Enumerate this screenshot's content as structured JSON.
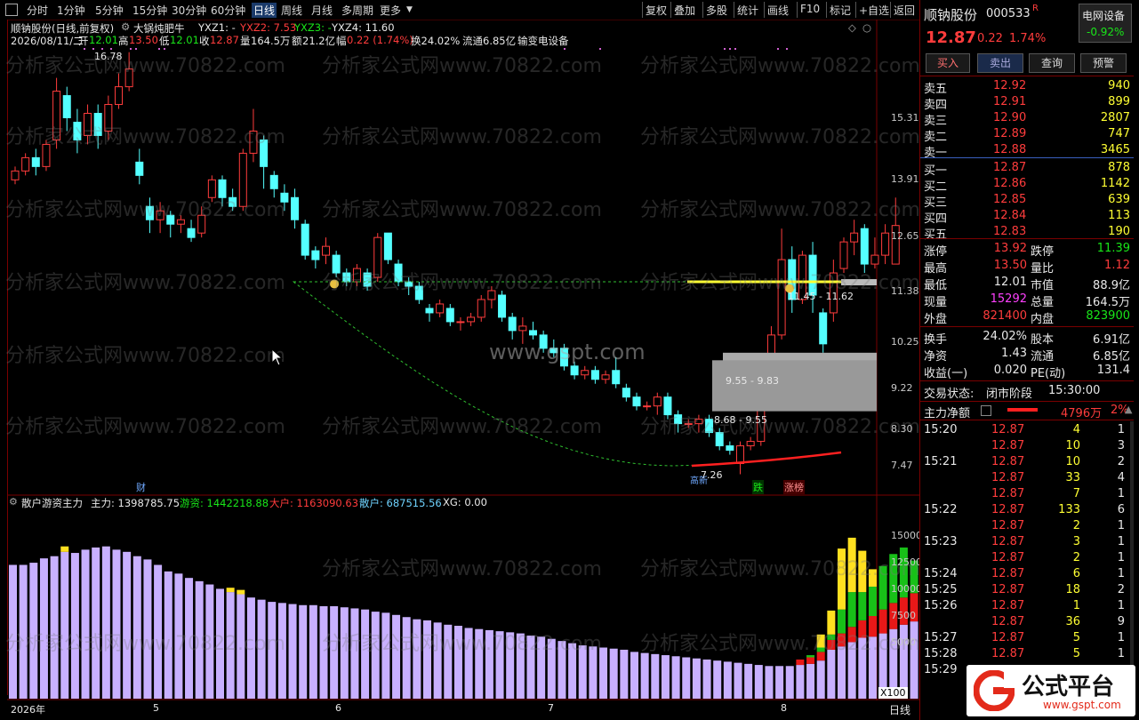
{
  "toolbar": {
    "periods": [
      "分时",
      "1分钟",
      "5分钟",
      "15分钟",
      "30分钟",
      "60分钟",
      "日线",
      "周线",
      "月线",
      "多周期",
      "更多"
    ],
    "active_period": "日线",
    "right_buttons": [
      "复权",
      "叠加",
      "多股",
      "统计",
      "画线",
      "F10",
      "标记",
      "+自选",
      "返回"
    ]
  },
  "chart_header": {
    "stock_label": "顺钠股份(日线,前复权)",
    "indicator_name": "大锅炖肥牛",
    "yxz1": "YXZ1: -",
    "yxz2": "YXZ2: 7.53",
    "yxz3": "YXZ3: -",
    "yxz4": "YXZ4: 11.60"
  },
  "quote_line": {
    "date": "2026/08/11/二",
    "open_label": "开",
    "open": "12.01",
    "high_label": "高",
    "high": "13.50",
    "low_label": "低",
    "low": "12.01",
    "close_label": "收",
    "close": "12.87",
    "vol_label": "量",
    "vol": "164.5万",
    "amount_label": "额",
    "amount": "21.2亿",
    "change_label": "幅",
    "change": "0.22 (1.74%)",
    "turnover": "换24.02%",
    "float": "流通6.85亿",
    "industry": "输变电设备"
  },
  "price_axis": [
    "15.31",
    "13.91",
    "12.65",
    "11.38",
    "10.25",
    "9.22",
    "8.30",
    "7.47"
  ],
  "chart_annotations": {
    "peak_label": "16.78",
    "low_label": "7.26",
    "box1": "11.45 - 11.62",
    "box2": "9.55 - 9.83",
    "box3": "8.68 - 9.55",
    "tag_cai": "财",
    "tag_die": "跌",
    "tag_zhangbang": "涨榜",
    "tag_gaoxin": "高新",
    "watermark": "分析家公式网www.70822.com",
    "watermark2": "www.gspt.com"
  },
  "sub_header": {
    "name": "散户游资主力",
    "zhuli": "主力: 1398785.75",
    "youzi": "游资: 1442218.88",
    "dahu": "大户: 1163090.63",
    "sanhu": "散户: 687515.56",
    "xg": "XG: 0.00"
  },
  "sub_axis": [
    "15000",
    "12500",
    "10000",
    "7500",
    "5000"
  ],
  "sub_axis_unit": "X100",
  "bottom_axis": {
    "labels": [
      "2026年",
      "5",
      "6",
      "7",
      "8"
    ],
    "right_label": "日线"
  },
  "stock_panel": {
    "name": "顺钠股份",
    "code": "000533",
    "r_badge": "R",
    "sector_name": "电网设备",
    "sector_change": "-0.92%",
    "price": "12.87",
    "change": "0.22",
    "change_pct": "1.74%",
    "buttons": [
      "买入",
      "卖出",
      "查询",
      "预警"
    ]
  },
  "sell_levels": [
    {
      "label": "卖五",
      "price": "12.92",
      "vol": "940"
    },
    {
      "label": "卖四",
      "price": "12.91",
      "vol": "899"
    },
    {
      "label": "卖三",
      "price": "12.90",
      "vol": "2807"
    },
    {
      "label": "卖二",
      "price": "12.89",
      "vol": "747"
    },
    {
      "label": "卖一",
      "price": "12.88",
      "vol": "3465"
    }
  ],
  "buy_levels": [
    {
      "label": "买一",
      "price": "12.87",
      "vol": "878"
    },
    {
      "label": "买二",
      "price": "12.86",
      "vol": "1142"
    },
    {
      "label": "买三",
      "price": "12.85",
      "vol": "639"
    },
    {
      "label": "买四",
      "price": "12.84",
      "vol": "113"
    },
    {
      "label": "买五",
      "price": "12.83",
      "vol": "190"
    }
  ],
  "stats": [
    {
      "l1": "涨停",
      "v1": "13.92",
      "c1": "red",
      "l2": "跌停",
      "v2": "11.39",
      "c2": "green"
    },
    {
      "l1": "最高",
      "v1": "13.50",
      "c1": "red",
      "l2": "量比",
      "v2": "1.12",
      "c2": "red"
    },
    {
      "l1": "最低",
      "v1": "12.01",
      "c1": "white",
      "l2": "市值",
      "v2": "88.9亿",
      "c2": "white"
    },
    {
      "l1": "现量",
      "v1": "15292",
      "c1": "magenta",
      "l2": "总量",
      "v2": "164.5万",
      "c2": "white"
    },
    {
      "l1": "外盘",
      "v1": "821400",
      "c1": "red",
      "l2": "内盘",
      "v2": "823900",
      "c2": "green"
    }
  ],
  "stats2": [
    {
      "l1": "换手",
      "v1": "24.02%",
      "l2": "股本",
      "v2": "6.91亿"
    },
    {
      "l1": "净资",
      "v1": "1.43",
      "l2": "流通",
      "v2": "6.85亿"
    },
    {
      "l1": "收益(一)",
      "v1": "0.020",
      "l2": "PE(动)",
      "v2": "131.4"
    }
  ],
  "trade_state": {
    "label": "交易状态:",
    "value": "闭市阶段",
    "time": "15:30:00"
  },
  "net_flow": {
    "label": "主力净额",
    "value": "4796万",
    "pct": "2%"
  },
  "ticks": [
    {
      "time": "15:20",
      "price": "12.87",
      "vol": "4",
      "n": "1"
    },
    {
      "time": "",
      "price": "12.87",
      "vol": "10",
      "n": "3"
    },
    {
      "time": "15:21",
      "price": "12.87",
      "vol": "10",
      "n": "2"
    },
    {
      "time": "",
      "price": "12.87",
      "vol": "33",
      "n": "4"
    },
    {
      "time": "",
      "price": "12.87",
      "vol": "7",
      "n": "1"
    },
    {
      "time": "15:22",
      "price": "12.87",
      "vol": "133",
      "n": "6"
    },
    {
      "time": "",
      "price": "12.87",
      "vol": "2",
      "n": "1"
    },
    {
      "time": "15:23",
      "price": "12.87",
      "vol": "3",
      "n": "1"
    },
    {
      "time": "",
      "price": "12.87",
      "vol": "2",
      "n": "1"
    },
    {
      "time": "15:24",
      "price": "12.87",
      "vol": "6",
      "n": "1"
    },
    {
      "time": "15:25",
      "price": "12.87",
      "vol": "18",
      "n": "2"
    },
    {
      "time": "15:26",
      "price": "12.87",
      "vol": "1",
      "n": "1"
    },
    {
      "time": "",
      "price": "12.87",
      "vol": "36",
      "n": "9"
    },
    {
      "time": "15:27",
      "price": "12.87",
      "vol": "5",
      "n": "1"
    },
    {
      "time": "15:28",
      "price": "12.87",
      "vol": "5",
      "n": "1"
    },
    {
      "time": "15:29",
      "price": "",
      "vol": "",
      "n": ""
    }
  ],
  "logo": {
    "text": "公式平台",
    "url": "www.gspt.com"
  }
}
